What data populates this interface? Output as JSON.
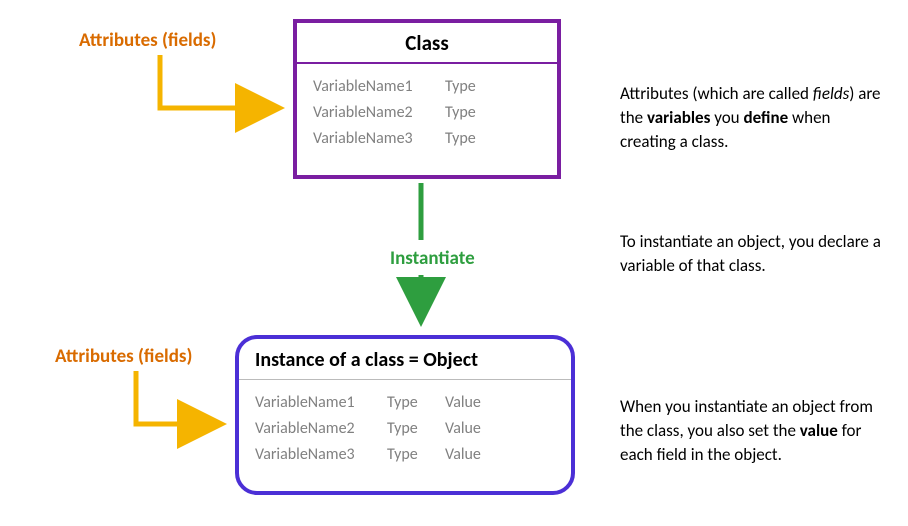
{
  "labels": {
    "attributes": "Attributes",
    "fields": "(fields)",
    "instantiate": "Instantiate"
  },
  "class_box": {
    "title": "Class",
    "rows": [
      {
        "name": "VariableName1",
        "type": "Type"
      },
      {
        "name": "VariableName2",
        "type": "Type"
      },
      {
        "name": "VariableName3",
        "type": "Type"
      }
    ]
  },
  "object_box": {
    "title_prefix": "Instance of a class",
    "title_eq": "=",
    "title_suffix": "Object",
    "rows": [
      {
        "name": "VariableName1",
        "type": "Type",
        "value": "Value"
      },
      {
        "name": "VariableName2",
        "type": "Type",
        "value": "Value"
      },
      {
        "name": "VariableName3",
        "type": "Type",
        "value": "Value"
      }
    ]
  },
  "side": {
    "p1_a": "Attributes (which are called ",
    "p1_b": "fields",
    "p1_c": ") are the ",
    "p1_d": "variables",
    "p1_e": " you ",
    "p1_f": "define",
    "p1_g": " when creating a class.",
    "p2": "To instantiate an object, you declare a variable of that class.",
    "p3_a": "When you instantiate an object from the class, you also set the ",
    "p3_b": "value",
    "p3_c": " for each field in the object."
  },
  "colors": {
    "orange": "#d96b00",
    "yellow_arrow": "#f5b400",
    "green": "#2e9e3f",
    "purple": "#7a1ea1",
    "indigo": "#4b2fd6"
  }
}
